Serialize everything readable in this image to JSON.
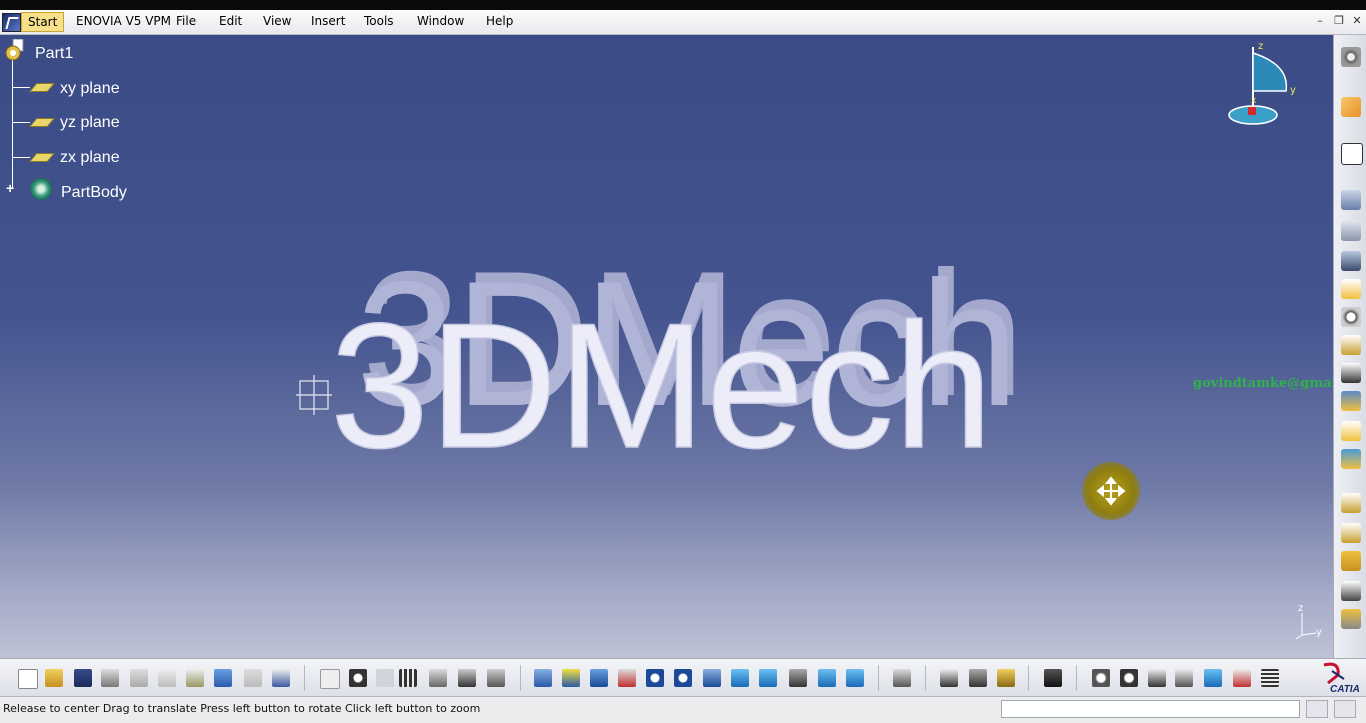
{
  "menubar": {
    "items": [
      "Start",
      "ENOVIA V5 VPM",
      "File",
      "Edit",
      "View",
      "Insert",
      "Tools",
      "Window",
      "Help"
    ]
  },
  "tree": {
    "root": "Part1",
    "planes": [
      "xy plane",
      "yz plane",
      "zx plane"
    ],
    "body": "PartBody"
  },
  "viewport": {
    "model_text": "3DMech",
    "watermark": "govindtamke@gmail.com",
    "compass_axes": [
      "z",
      "y",
      "x"
    ],
    "axis_labels": [
      "z",
      "y"
    ]
  },
  "statusbar": {
    "message": "Release to center  Drag to translate  Press left button to rotate  Click left button to zoom"
  },
  "brand": "CATIA",
  "colors": {
    "background_top": "#3b4b86",
    "background_bottom": "#bfc3d6",
    "model": "#e8e8f6",
    "tree_plane": "#e9d66a"
  }
}
